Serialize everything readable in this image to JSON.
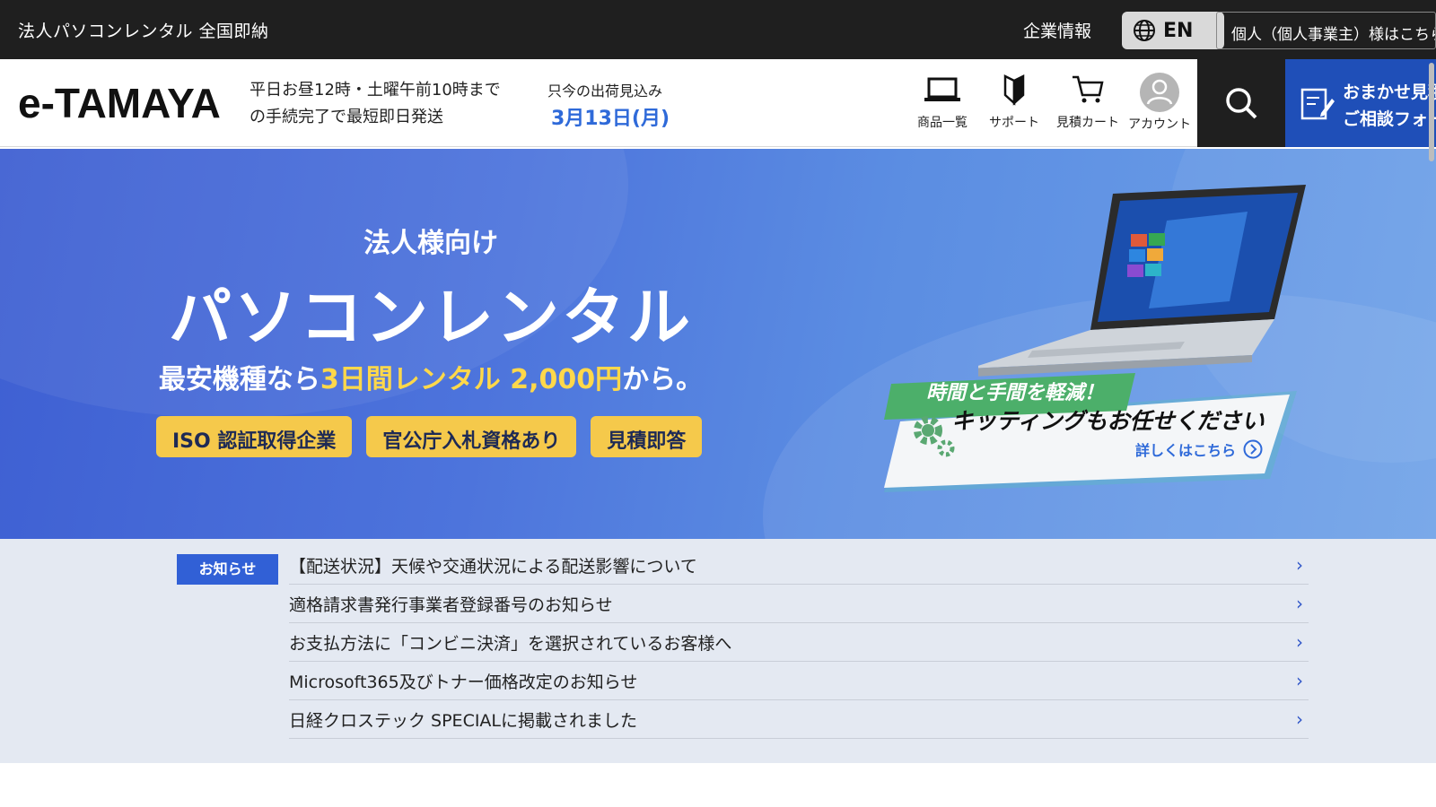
{
  "topbar": {
    "tagline": "法人パソコンレンタル 全国即納",
    "company_link": "企業情報",
    "lang_button": "EN",
    "personal_link": "個人（個人事業主）様はこちら"
  },
  "header": {
    "logo": "e-TAMAYA",
    "ship_line1": "平日お昼12時・土曜午前10時まで",
    "ship_line2": "の手続完了で最短即日発送",
    "eta_label": "只今の出荷見込み",
    "eta_date": "3月13日(月)",
    "nav": [
      {
        "label": "商品一覧",
        "icon": "laptop-icon"
      },
      {
        "label": "サポート",
        "icon": "beginner-mark-icon"
      },
      {
        "label": "見積カート",
        "icon": "cart-icon"
      },
      {
        "label": "アカウント",
        "icon": "account-icon"
      }
    ],
    "consult_line1": "おまかせ見積",
    "consult_line2": "ご相談フォーム"
  },
  "hero": {
    "pre_title": "法人様向け",
    "title": "パソコンレンタル",
    "sub_prefix": "最安機種なら",
    "sub_highlight": "3日間レンタル 2,000円",
    "sub_suffix": "から。",
    "badges": [
      "ISO 認証取得企業",
      "官公庁入札資格あり",
      "見積即答"
    ],
    "kitting_ribbon": "時間と手間を軽減！",
    "kitting_title": "キッティングもお任せください",
    "kitting_link": "詳しくはこちら",
    "colors": {
      "accent_yellow": "#f5c94b",
      "highlight": "#ffd84a",
      "ribbon_green": "#4caf6a",
      "brand_blue": "#1f4fb8"
    }
  },
  "news": {
    "tag": "お知らせ",
    "items": [
      "【配送状況】天候や交通状況による配送影響について",
      "適格請求書発行事業者登録番号のお知らせ",
      "お支払方法に「コンビニ決済」を選択されているお客様へ",
      "Microsoft365及びトナー価格改定のお知らせ",
      "日経クロステック SPECIALに掲載されました"
    ]
  }
}
